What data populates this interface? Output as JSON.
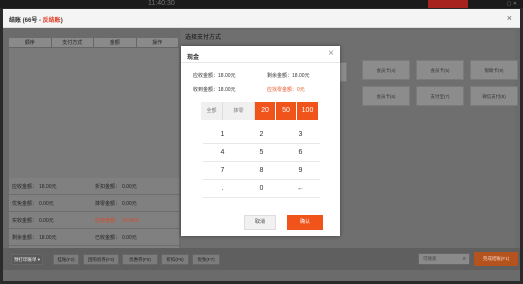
{
  "top": {
    "clock": "11:40:30"
  },
  "window": {
    "title_prefix": "结账 (66号 - ",
    "title_status": "反结账",
    "title_suffix": ")"
  },
  "table_headers": [
    "顺序",
    "支付方式",
    "金额",
    "操作"
  ],
  "summary": {
    "row1": {
      "l": "应收金额：",
      "lv": "18.00元",
      "r": "折扣金额：",
      "rv": "0.00元"
    },
    "row2": {
      "l": "优免金额：",
      "lv": "0.00元",
      "r": "抹零金额：",
      "rv": "0.00元"
    },
    "row3": {
      "l": "实收金额：",
      "lv": "0.00元",
      "r": "应找金额：",
      "rv": "18.00元"
    },
    "row4": {
      "l": "剩余金额：",
      "lv": "18.00元",
      "r": "已收金额：",
      "rv": "0.00元"
    }
  },
  "right_panel": {
    "title": "选择支付方式",
    "methods": [
      "会员卡(4)",
      "会员卡(5)",
      "会员卡(6)",
      "支付宝(7)",
      "微信支付(8)",
      "银联卡(9)"
    ]
  },
  "bottom": {
    "print": "预打印账单 ▾",
    "b1": "挂账(F2)",
    "b2": "团购验券(F3)",
    "b3": "优惠券(F5)",
    "b4": "折扣(F6)",
    "b5": "优免(F7)",
    "search_placeholder": "可搜索",
    "complete": "完成结账(F1)"
  },
  "modal": {
    "title": "现金",
    "receivable_label": "应收金额：",
    "receivable_value": "18.00元",
    "remaining_label": "剩余金额：",
    "remaining_value": "18.00元",
    "collected_label": "收到金额：",
    "collected_value": "18.00元",
    "change_label": "应找零金额：",
    "change_value": "0元",
    "quick": {
      "all": "全部",
      "other": "抹零",
      "q1": "20",
      "q2": "50",
      "q3": "100"
    },
    "keys": [
      "1",
      "2",
      "3",
      "4",
      "5",
      "6",
      "7",
      "8",
      "9",
      ".",
      "0",
      "←"
    ],
    "cancel": "取消",
    "confirm": "确认"
  }
}
